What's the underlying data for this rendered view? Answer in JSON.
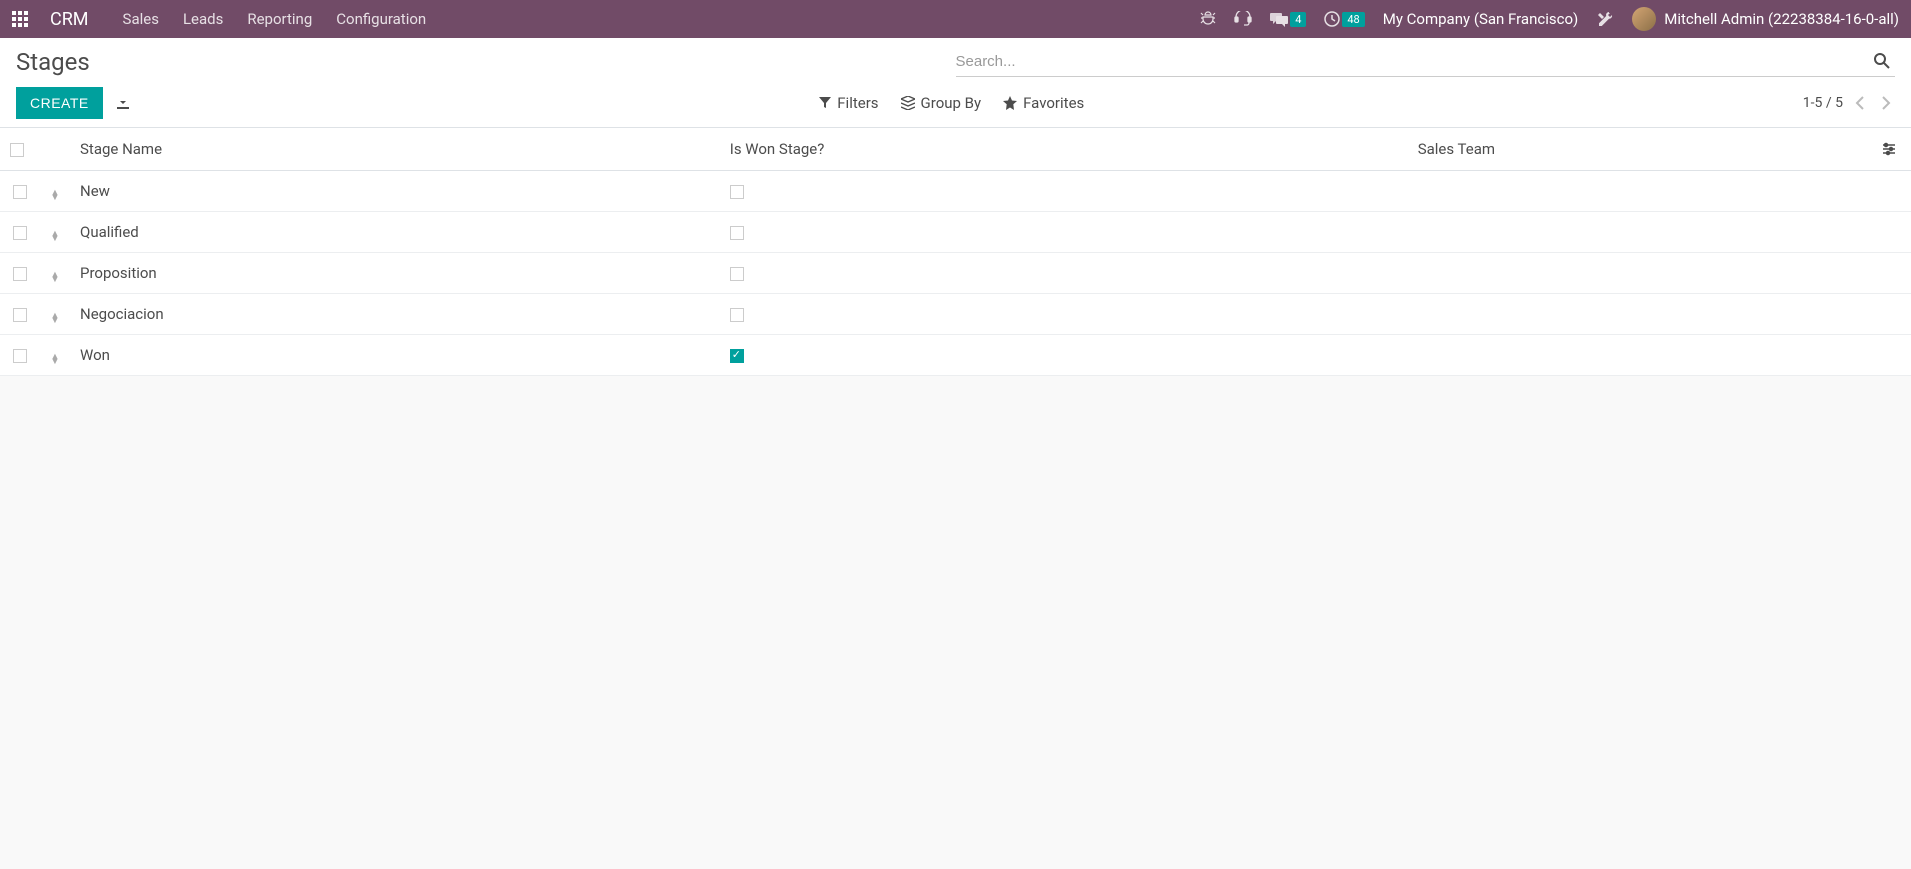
{
  "navbar": {
    "brand": "CRM",
    "menu": [
      {
        "label": "Sales"
      },
      {
        "label": "Leads"
      },
      {
        "label": "Reporting"
      },
      {
        "label": "Configuration"
      }
    ],
    "messages_badge": "4",
    "activities_badge": "48",
    "company": "My Company (San Francisco)",
    "user": "Mitchell Admin (22238384-16-0-all)"
  },
  "control_panel": {
    "title": "Stages",
    "search_placeholder": "Search...",
    "create_label": "CREATE",
    "filters_label": "Filters",
    "groupby_label": "Group By",
    "favorites_label": "Favorites",
    "pager": "1-5 / 5"
  },
  "table": {
    "columns": {
      "name": "Stage Name",
      "is_won": "Is Won Stage?",
      "team": "Sales Team"
    },
    "rows": [
      {
        "name": "New",
        "is_won": false,
        "team": ""
      },
      {
        "name": "Qualified",
        "is_won": false,
        "team": ""
      },
      {
        "name": "Proposition",
        "is_won": false,
        "team": ""
      },
      {
        "name": "Negociacion",
        "is_won": false,
        "team": ""
      },
      {
        "name": "Won",
        "is_won": true,
        "team": ""
      }
    ]
  }
}
